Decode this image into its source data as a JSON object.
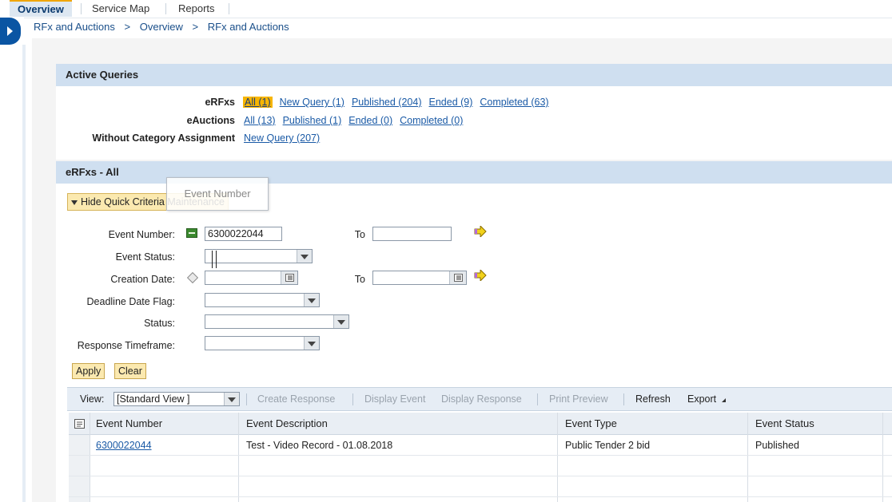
{
  "tabs": [
    {
      "label": "Overview",
      "active": true
    },
    {
      "label": "Service Map",
      "active": false
    },
    {
      "label": "Reports",
      "active": false
    }
  ],
  "breadcrumb": [
    "RFx and Auctions",
    ">",
    "Overview",
    ">",
    "RFx and Auctions"
  ],
  "active_queries": {
    "title": "Active Queries",
    "rows": [
      {
        "label": "eRFxs",
        "links": [
          "All (1)",
          "New Query (1)",
          "Published (204)",
          "Ended (9)",
          "Completed (63)"
        ],
        "selected_index": 0
      },
      {
        "label": "eAuctions",
        "links": [
          "All (13)",
          "Published (1)",
          "Ended (0)",
          "Completed (0)"
        ]
      },
      {
        "label": "Without Category Assignment",
        "links": [
          "New Query (207)"
        ]
      }
    ]
  },
  "results_section": {
    "title": "eRFxs - All",
    "hide_criteria_label": "Hide Quick Criteria Maintenance",
    "tooltip": "Event Number"
  },
  "criteria": {
    "event_number": {
      "label": "Event Number:",
      "value": "6300022044",
      "to_label": "To",
      "to_value": ""
    },
    "event_status": {
      "label": "Event Status:",
      "value": ""
    },
    "creation_date": {
      "label": "Creation Date:",
      "value": "",
      "to_label": "To",
      "to_value": ""
    },
    "deadline_date_flag": {
      "label": "Deadline Date Flag:",
      "value": ""
    },
    "status": {
      "label": "Status:",
      "value": ""
    },
    "response_timeframe": {
      "label": "Response Timeframe:",
      "value": ""
    },
    "apply_label": "Apply",
    "clear_label": "Clear"
  },
  "toolbar": {
    "view_label": "View:",
    "view_value": "[Standard View ]",
    "create_response": "Create Response",
    "display_event": "Display Event",
    "display_response": "Display Response",
    "print_preview": "Print Preview",
    "refresh": "Refresh",
    "export": "Export"
  },
  "table": {
    "columns": [
      "Event Number",
      "Event Description",
      "Event Type",
      "Event Status"
    ],
    "rows": [
      {
        "event_number": "6300022044",
        "description": "Test - Video Record - 01.08.2018",
        "type": "Public Tender 2 bid",
        "status": "Published"
      }
    ]
  },
  "colors": {
    "accent_blue": "#0a55a3",
    "section_header": "#cfdff0",
    "selected_link_bg": "#f7b500",
    "link": "#1a5aa6",
    "button_bg": "#fbe9b0"
  }
}
